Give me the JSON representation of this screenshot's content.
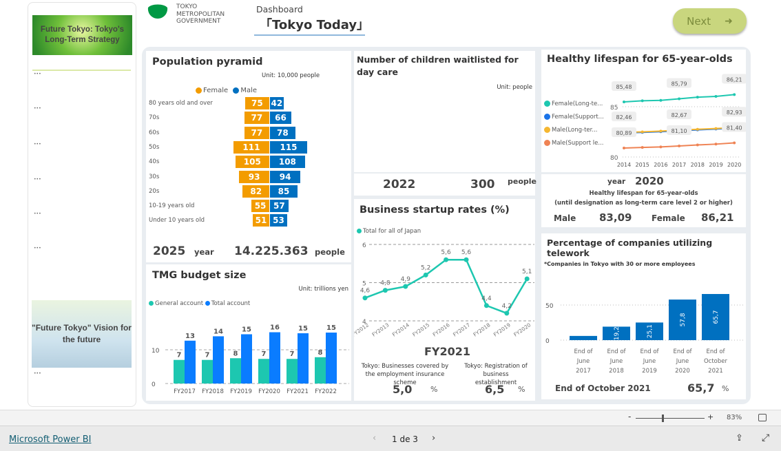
{
  "header": {
    "org_name": [
      "TOKYO",
      "METROPOLITAN",
      "GOVERNMENT"
    ],
    "dashboard_label": "Dashboard",
    "title": "「Tokyo Today」",
    "next_label": "Next",
    "next_icon": "arrow-right-icon",
    "logo_color": "#009944"
  },
  "sidebar": {
    "banner1": "Future Tokyo: Tokyo's Long-Term Strategy",
    "banner2": "\"Future Tokyo\" Vision for the future"
  },
  "population": {
    "title": "Population pyramid",
    "unit": "Unit: 10,000 people",
    "legend": [
      "Female",
      "Male"
    ],
    "colors": {
      "female": "#f39c00",
      "male": "#0070c0"
    },
    "rows": [
      {
        "label": "80 years old and over",
        "female": 75,
        "male": 42
      },
      {
        "label": "70s",
        "female": 77,
        "male": 66
      },
      {
        "label": "60s",
        "female": 77,
        "male": 78
      },
      {
        "label": "50s",
        "female": 111,
        "male": 115
      },
      {
        "label": "40s",
        "female": 105,
        "male": 108
      },
      {
        "label": "30s",
        "female": 93,
        "male": 94
      },
      {
        "label": "20s",
        "female": 82,
        "male": 85
      },
      {
        "label": "10-19 years old",
        "female": 55,
        "male": 57
      },
      {
        "label": "Under 10 years old",
        "female": 51,
        "male": 53
      }
    ],
    "year": "2025",
    "year_label": "year",
    "total": "14.225.363",
    "total_unit": "people"
  },
  "children": {
    "title": "Number of children waitlisted for day care",
    "unit": "Unit: people",
    "year": "2022",
    "value": "300",
    "value_unit": "people"
  },
  "healthy": {
    "title": "Healthy lifespan for 65-year-olds",
    "year_label": "year",
    "year": "2020",
    "subtitle1": "Healthy lifespan for 65-year-olds",
    "subtitle2": "(until designation as long-term care level 2 or higher)",
    "male_label": "Male",
    "male_value": "83,09",
    "female_label": "Female",
    "female_value": "86,21"
  },
  "startup": {
    "title": "Business startup rates (%)",
    "fy": "FY2021",
    "stat1_label": "Tokyo: Businesses covered by the employment insurance scheme",
    "stat1_value": "5,0",
    "stat2_label": "Tokyo: Registration of business establishment",
    "stat2_value": "6,5",
    "pct": "%"
  },
  "budget": {
    "title": "TMG budget size",
    "unit": "Unit: trillions yen"
  },
  "telework": {
    "title": "Percentage of companies utilizing telework",
    "note": "*Companies in Tokyo with 30 or more employees",
    "footer_label": "End of October 2021",
    "footer_value": "65,7",
    "pct": "%"
  },
  "bottom": {
    "zoom": "83%",
    "brand": "Microsoft Power BI",
    "page": "1 de 3"
  },
  "chart_data": [
    {
      "type": "line",
      "id": "healthy",
      "x": [
        2014,
        2015,
        2016,
        2017,
        2018,
        2019,
        2020
      ],
      "ylim": [
        80,
        87
      ],
      "yticks": [
        80,
        85
      ],
      "legend_placement": "left",
      "series": [
        {
          "name": "Female(Long-te...",
          "color": "#1dc7b0",
          "values": [
            85.48,
            85.59,
            85.63,
            85.79,
            85.95,
            86.03,
            86.21
          ],
          "labels": {
            "2014": "85,48",
            "2017": "85,79",
            "2020": "86,21"
          }
        },
        {
          "name": "Female(Support...",
          "color": "#1a73e8",
          "values": [
            82.4,
            82.45,
            82.52,
            82.6,
            82.7,
            82.78,
            82.85
          ]
        },
        {
          "name": "Male(Long-ter...",
          "color": "#f5b731",
          "values": [
            82.46,
            82.5,
            82.58,
            82.67,
            82.76,
            82.83,
            82.93
          ],
          "labels": {
            "2014": "82,46",
            "2017": "82,67",
            "2020": "82,93"
          }
        },
        {
          "name": "Male(Support le...",
          "color": "#ef8354",
          "values": [
            80.89,
            80.95,
            81.0,
            81.1,
            81.2,
            81.28,
            81.4
          ],
          "labels": {
            "2014": "80,89",
            "2017": "81,10",
            "2020": "81,40"
          }
        }
      ]
    },
    {
      "type": "line",
      "id": "startup",
      "categories": [
        "FY2012",
        "FY2013",
        "FY2014",
        "FY2015",
        "FY2016",
        "FY2017",
        "FY2018",
        "FY2019",
        "FY2020"
      ],
      "ylim": [
        4,
        6
      ],
      "yticks": [
        4,
        5,
        6
      ],
      "series": [
        {
          "name": "Total for all of Japan",
          "color": "#1dc7b0",
          "values": [
            4.6,
            4.8,
            4.9,
            5.2,
            5.6,
            5.6,
            4.4,
            4.2,
            5.1
          ],
          "labels": [
            "4,6",
            "4,8",
            "4,9",
            "5,2",
            "5,6",
            "5,6",
            "4,4",
            "4,2",
            "5,1"
          ]
        }
      ]
    },
    {
      "type": "bar",
      "id": "budget",
      "categories": [
        "FY2017",
        "FY2018",
        "FY2019",
        "FY2020",
        "FY2021",
        "FY2022"
      ],
      "yticks": [
        0,
        10
      ],
      "series": [
        {
          "name": "General account",
          "color": "#1dc7b0",
          "values": [
            7,
            7,
            7.5,
            7.3,
            7.3,
            7.8
          ],
          "labels": [
            "7",
            "7",
            "8",
            "7",
            "7",
            "8"
          ]
        },
        {
          "name": "Total account",
          "color": "#0a7cff",
          "values": [
            12.7,
            14,
            14.6,
            15.2,
            14.9,
            15.1
          ],
          "labels": [
            "13",
            "14",
            "15",
            "16",
            "15",
            "15"
          ]
        }
      ]
    },
    {
      "type": "bar",
      "id": "telework",
      "categories": [
        "End of June 2017",
        "End of June 2018",
        "End of June 2019",
        "End of June 2020",
        "End of October 2021"
      ],
      "yticks": [
        0,
        50
      ],
      "color": "#0070c0",
      "values": [
        6,
        19.2,
        25.1,
        57.8,
        65.7
      ],
      "labels": [
        "",
        "19,2",
        "25,1",
        "57,8",
        "65,7"
      ]
    }
  ]
}
